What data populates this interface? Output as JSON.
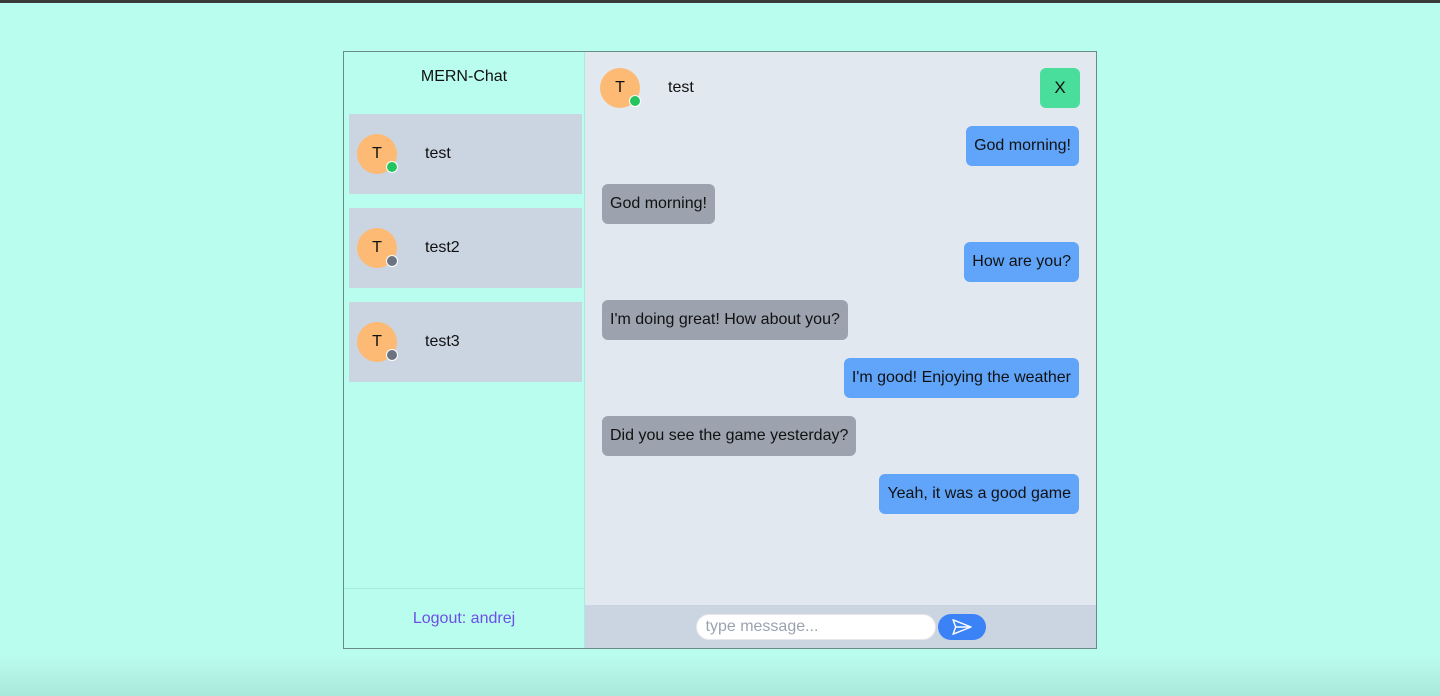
{
  "app": {
    "brand": "MERN-Chat",
    "logout_label": "Logout: andrej"
  },
  "colors": {
    "background": "#b9fdef",
    "sidebar_item": "#cbd5e1",
    "chat_bg": "#e2e8f0",
    "avatar": "#fdba74",
    "online": "#22c55e",
    "offline": "#6b7280",
    "my_bubble": "#60a5fa",
    "their_bubble": "#9ca3af",
    "close_button": "#4ade9c",
    "send_button": "#3b82f6",
    "logout_text": "#6d4ee6"
  },
  "contacts": [
    {
      "initial": "T",
      "name": "test",
      "status": "online"
    },
    {
      "initial": "T",
      "name": "test2",
      "status": "offline"
    },
    {
      "initial": "T",
      "name": "test3",
      "status": "offline"
    }
  ],
  "chat": {
    "header": {
      "initial": "T",
      "name": "test",
      "status": "online",
      "close_label": "X"
    },
    "messages": [
      {
        "from": "me",
        "text": "God morning!"
      },
      {
        "from": "them",
        "text": "God morning!"
      },
      {
        "from": "me",
        "text": "How are you?"
      },
      {
        "from": "them",
        "text": "I'm doing great! How about you?"
      },
      {
        "from": "me",
        "text": "I'm good! Enjoying the weather"
      },
      {
        "from": "them",
        "text": "Did you see the game yesterday?"
      },
      {
        "from": "me",
        "text": "Yeah, it was a good game"
      }
    ],
    "input": {
      "value": "",
      "placeholder": "type message..."
    },
    "send_icon": "send-icon"
  }
}
